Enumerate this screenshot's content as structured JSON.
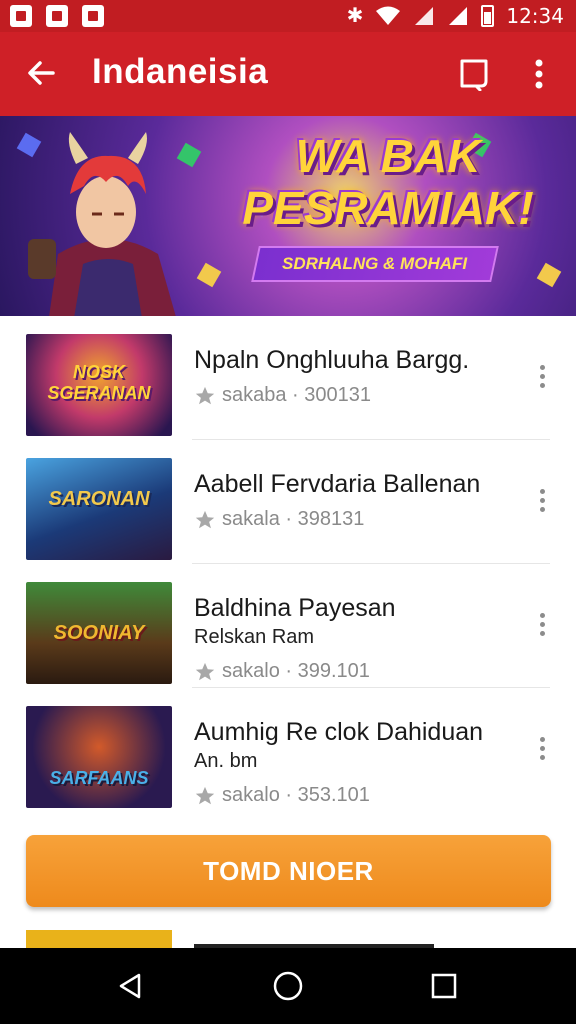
{
  "status_bar": {
    "time": "12:34",
    "icons": [
      "notification-icon",
      "notification-icon",
      "notification-icon",
      "bluetooth-icon",
      "wifi-icon",
      "signal-icon",
      "signal-icon",
      "battery-icon"
    ]
  },
  "app_bar": {
    "title": "Indaneisia",
    "back_icon": "arrow-left-icon",
    "bookmark_icon": "bookmark-icon",
    "menu_icon": "more-vertical-icon"
  },
  "banner": {
    "headline_line1": "WA BAK",
    "headline_line2": "PESRAMIAK!",
    "ribbon": "SDRHALNG & MOHAFI"
  },
  "list": {
    "items": [
      {
        "title": "Npaln Onghluuha Bargg.",
        "subtitle": "",
        "meta": "sakaba · 300131",
        "thumb_text": "NOSK SGERANAN",
        "thumb_colors": [
          "#2a1650",
          "#c23a6a",
          "#f1a52c"
        ]
      },
      {
        "title": "Aabell Fervdaria Ballenan",
        "subtitle": "",
        "meta": "sakala · 398131",
        "thumb_text": "SARONAN",
        "thumb_colors": [
          "#1b3a78",
          "#4aa3e0",
          "#f2c94c"
        ]
      },
      {
        "title": "Baldhina Payesan",
        "subtitle": "Relskan Ram",
        "meta": "sakalo · 399.101",
        "thumb_text": "SOONIAY",
        "thumb_colors": [
          "#5a3a1a",
          "#3f8a3a",
          "#f0b830"
        ]
      },
      {
        "title": "Aumhig Re clok Dahiduan",
        "subtitle": "An. bm",
        "meta": "sakalo · 353.101",
        "thumb_text": "SARFAANS",
        "thumb_colors": [
          "#2a1a50",
          "#d25a2a",
          "#4ab0e8"
        ]
      }
    ]
  },
  "cta": {
    "label": "TOMD NIOER"
  },
  "nav_bar": {
    "back_icon": "nav-back-icon",
    "home_icon": "nav-home-icon",
    "recents_icon": "nav-recents-icon"
  },
  "colors": {
    "primary": "#cf2027",
    "status": "#c11d22",
    "accent": "#f39a2b",
    "meta": "#8a8a8a"
  }
}
